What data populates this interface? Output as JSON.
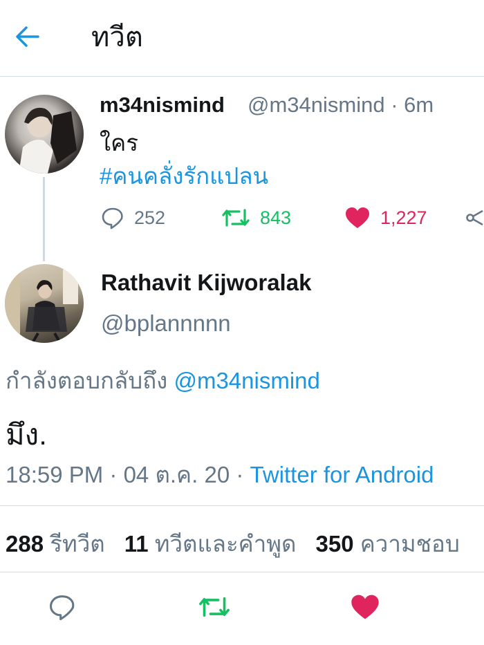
{
  "header": {
    "title": "ทวีต",
    "back_icon": "arrow-left-icon"
  },
  "quoted_tweet": {
    "display_name": "m34nismind",
    "handle_time": "@m34nismind · 6m",
    "text": "ใคร",
    "hashtag": "#คนคลั่งรักแปลน",
    "actions": {
      "reply_count": "252",
      "retweet_count": "843",
      "like_count": "1,227"
    }
  },
  "main_tweet": {
    "display_name": "Rathavit Kijworalak",
    "handle": "@bplannnnn",
    "replying_prefix": "กำลังตอบกลับถึง ",
    "replying_mention": "@m34nismind",
    "text": "มึง.",
    "timestamp": "18:59 PM · 04 ต.ค. 20 · ",
    "source": "Twitter for Android"
  },
  "stats": {
    "retweets_num": "288",
    "retweets_label": "รีทวีต",
    "quotes_num": "11",
    "quotes_label": "ทวีตและคำพูด",
    "likes_num": "350",
    "likes_label": "ความชอบ"
  },
  "colors": {
    "accent": "#1b95e0",
    "retweet": "#17bf63",
    "like": "#e0245e",
    "muted": "#657786",
    "divider": "#d6dde2"
  }
}
